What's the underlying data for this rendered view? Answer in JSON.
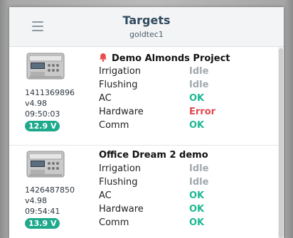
{
  "header": {
    "title": "Targets",
    "subtitle": "goldtec1"
  },
  "colors": {
    "idle": "#a3a9ae",
    "ok": "#1fb894",
    "error": "#e0494f",
    "alert_bell": "#e94b4f",
    "voltage_badge": "#1fa98c"
  },
  "targets": [
    {
      "id": "1411369896",
      "version": "v4.98",
      "time": "09:50:03",
      "voltage": "12.9 V",
      "name": "Demo Almonds Project",
      "alert": true,
      "rows": [
        {
          "label": "Irrigation",
          "value": "Idle",
          "status": "idle"
        },
        {
          "label": "Flushing",
          "value": "Idle",
          "status": "idle"
        },
        {
          "label": "AC",
          "value": "OK",
          "status": "ok"
        },
        {
          "label": "Hardware",
          "value": "Error",
          "status": "error"
        },
        {
          "label": "Comm",
          "value": "OK",
          "status": "ok"
        }
      ]
    },
    {
      "id": "1426487850",
      "version": "v4.98",
      "time": "09:54:41",
      "voltage": "13.9 V",
      "name": "Office Dream 2 demo",
      "alert": false,
      "rows": [
        {
          "label": "Irrigation",
          "value": "Idle",
          "status": "idle"
        },
        {
          "label": "Flushing",
          "value": "Idle",
          "status": "idle"
        },
        {
          "label": "AC",
          "value": "OK",
          "status": "ok"
        },
        {
          "label": "Hardware",
          "value": "OK",
          "status": "ok"
        },
        {
          "label": "Comm",
          "value": "OK",
          "status": "ok"
        }
      ]
    }
  ]
}
